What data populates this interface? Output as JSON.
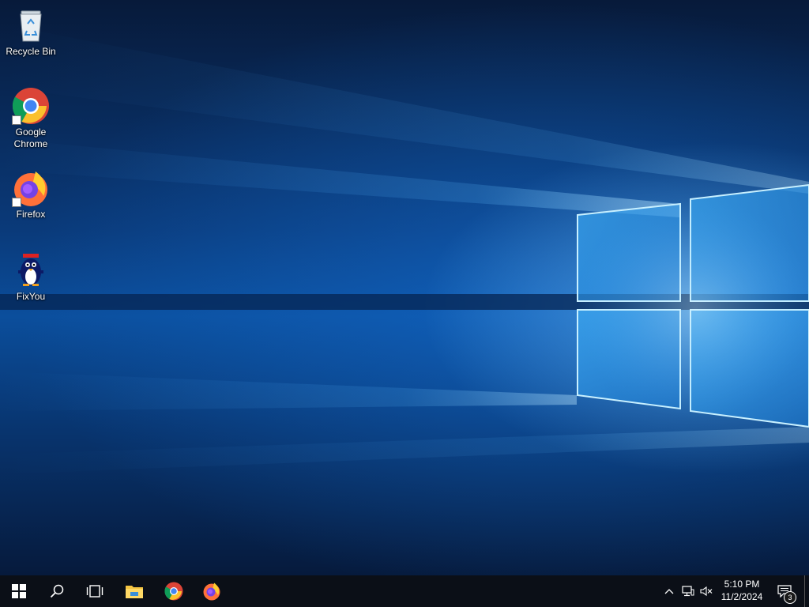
{
  "desktop_icons": [
    {
      "label": "Recycle Bin",
      "icon": "recycle-bin-icon"
    },
    {
      "label": "Google Chrome",
      "icon": "chrome-icon",
      "shortcut": true
    },
    {
      "label": "Firefox",
      "icon": "firefox-icon",
      "shortcut": true
    },
    {
      "label": "FixYou",
      "icon": "penguin-icon"
    }
  ],
  "taskbar": {
    "buttons": [
      "windows-start-icon",
      "search-icon",
      "task-view-icon",
      "file-explorer-icon",
      "chrome-icon",
      "firefox-icon"
    ],
    "tray": {
      "icons": [
        "chevron-up-icon",
        "network-icon",
        "volume-muted-icon"
      ],
      "time": "5:10 PM",
      "date": "11/2/2024",
      "notification_count": "3"
    }
  },
  "colors": {
    "taskbar": "#0b0f17",
    "accent_light": "#8fd6ff",
    "wallpaper_deep": "#071a3a"
  }
}
